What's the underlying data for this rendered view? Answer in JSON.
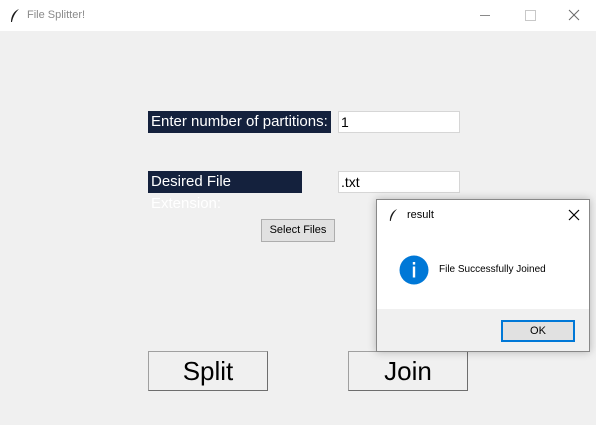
{
  "window": {
    "title": "File Splitter!"
  },
  "form": {
    "partitions_label": "Enter number of partitions:",
    "partitions_value": "1",
    "extension_label": "Desired File Extension:",
    "extension_value": ".txt",
    "select_files_label": "Select Files"
  },
  "actions": {
    "split_label": "Split",
    "join_label": "Join"
  },
  "dialog": {
    "title": "result",
    "message": "File Successfully Joined",
    "ok_label": "OK"
  },
  "icons": {
    "app": "feather-icon",
    "info": "info-icon"
  },
  "colors": {
    "label_bg": "#14213d",
    "label_text": "#ffffff",
    "info_blue": "#0078d7",
    "focus_border": "#0078d7"
  }
}
